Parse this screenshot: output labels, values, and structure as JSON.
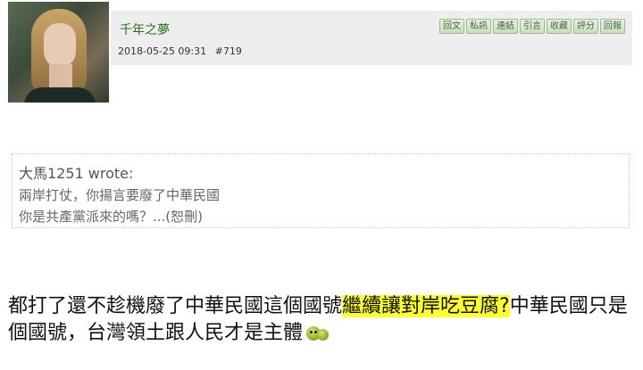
{
  "post": {
    "username": "千年之夢",
    "datetime": "2018-05-25 09:31",
    "post_number": "#719",
    "actions": [
      "回文",
      "私訊",
      "連結",
      "引言",
      "收藏",
      "評分",
      "回報"
    ]
  },
  "quote": {
    "author": "大馬1251 wrote:",
    "lines": [
      "兩岸打仗，你揚言要廢了中華民國",
      "你是共產黨派來的嗎？...(恕刪)"
    ]
  },
  "body": {
    "before": "都打了還不趁機廢了中華民國這個國號",
    "highlight": "繼續讓對岸吃豆腐?",
    "after": "中華民國只是個國號，台灣領土跟人民才是主體",
    "emoticon": "green-smiley-icon",
    "highlight_color": "#ffff33"
  }
}
